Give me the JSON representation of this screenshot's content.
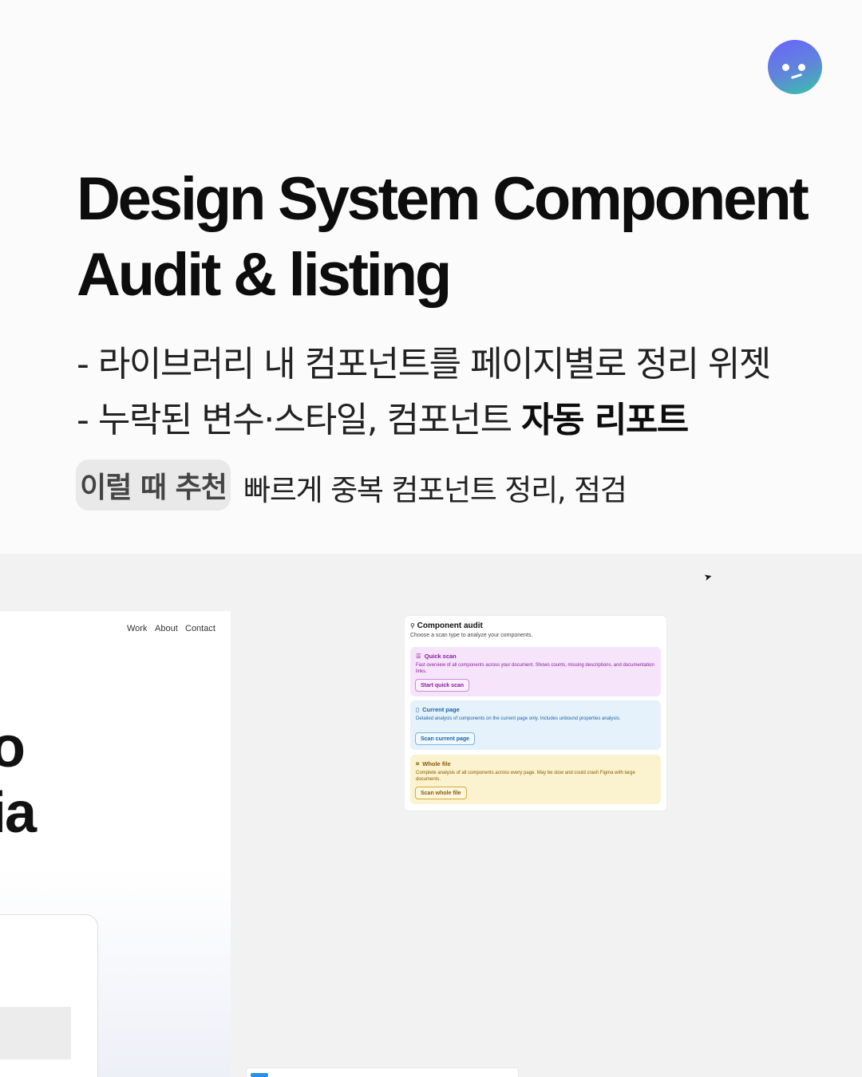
{
  "title": {
    "line1": "Design System Component",
    "line2": "Audit & listing"
  },
  "bullets": {
    "line1": "- 라이브러리 내 컴포넌트를 페이지별로 정리 위젯",
    "line2_prefix": "- 누락된 변수·스타일, 컴포넌트 ",
    "line2_bold": "자동 리포트"
  },
  "recommend": {
    "badge": "이럴 때 추천",
    "text": "빠르게 중복 컴포넌트 정리, 점검"
  },
  "website": {
    "nav": {
      "work": "Work",
      "about": "About",
      "contact": "Contact"
    },
    "hero_line1": "o",
    "hero_line2": "ia"
  },
  "audit_panel": {
    "title": "Component audit",
    "subtitle": "Choose a scan type to analyze your components.",
    "options": [
      {
        "label": "Quick scan",
        "description": "Fast overview of all components across your document. Shows counts, missing descriptions, and documentation links.",
        "button": "Start quick scan",
        "icon": "list-icon",
        "color": "#8a1c9c"
      },
      {
        "label": "Current page",
        "description": "Detailed analysis of components on the current page only. Includes unbound properties analysis.",
        "button": "Scan current page",
        "icon": "page-icon",
        "color": "#1a64a8"
      },
      {
        "label": "Whole file",
        "description": "Complete analysis of all components across every page. May be slow and could crash Figma with large documents.",
        "button": "Scan whole file",
        "icon": "scan-icon",
        "color": "#8a5a00"
      }
    ]
  }
}
